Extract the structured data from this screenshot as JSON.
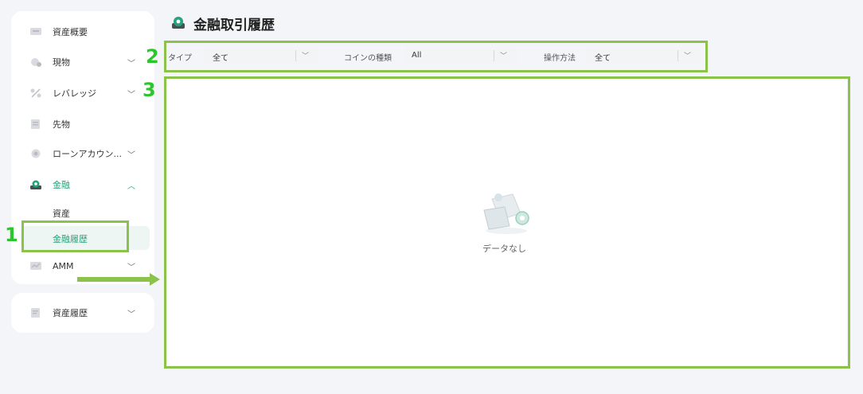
{
  "page": {
    "title": "金融取引履歴"
  },
  "sidebar": {
    "items": [
      {
        "label": "資産概要",
        "icon": "asset-overview-icon"
      },
      {
        "label": "現物",
        "icon": "spot-icon",
        "chevron": "﹀"
      },
      {
        "label": "レバレッジ",
        "icon": "leverage-icon",
        "chevron": "﹀"
      },
      {
        "label": "先物",
        "icon": "futures-icon"
      },
      {
        "label": "ローンアカウン...",
        "icon": "loan-icon",
        "chevron": "﹀"
      },
      {
        "label": "金融",
        "icon": "finance-icon",
        "chevron": "︿"
      },
      {
        "label": "AMM",
        "icon": "amm-icon",
        "chevron": "﹀"
      }
    ],
    "finance_sub": [
      {
        "label": "資産"
      },
      {
        "label": "金融履歴"
      }
    ],
    "bottom": {
      "label": "資産履歴",
      "icon": "asset-history-icon",
      "chevron": "﹀"
    }
  },
  "filters": {
    "type": {
      "label": "タイプ",
      "value": "全て"
    },
    "coin": {
      "label": "コインの種類",
      "value": "All"
    },
    "operation": {
      "label": "操作方法",
      "value": "全て"
    }
  },
  "empty": {
    "text": "データなし"
  },
  "annotations": {
    "n1": "1",
    "n2": "2",
    "n3": "3"
  },
  "colors": {
    "accent": "#25a37a",
    "annotation": "#8bc34a",
    "annotation_number": "#2bc62b"
  }
}
